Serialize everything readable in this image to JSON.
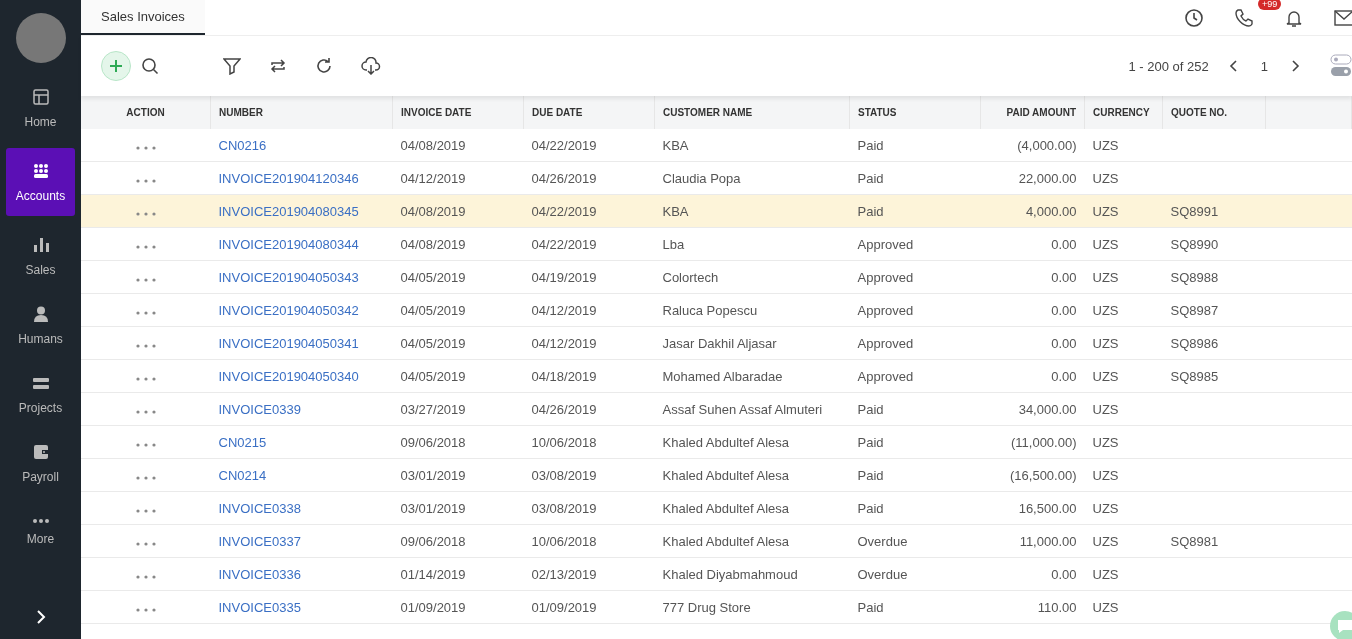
{
  "sidebar": {
    "items": [
      {
        "label": "Home",
        "selected": false
      },
      {
        "label": "Accounts",
        "selected": true
      },
      {
        "label": "Sales",
        "selected": false
      },
      {
        "label": "Humans",
        "selected": false
      },
      {
        "label": "Projects",
        "selected": false
      },
      {
        "label": "Payroll",
        "selected": false
      },
      {
        "label": "More",
        "selected": false
      }
    ]
  },
  "tabs": [
    {
      "label": "Sales Invoices",
      "selected": true
    }
  ],
  "header": {
    "notification_badge": "+99"
  },
  "pagination": {
    "range": "1 - 200 of 252",
    "page": "1"
  },
  "table": {
    "columns": [
      "ACTION",
      "NUMBER",
      "INVOICE DATE",
      "DUE DATE",
      "CUSTOMER NAME",
      "STATUS",
      "PAID AMOUNT",
      "CURRENCY",
      "QUOTE NO."
    ],
    "rows": [
      {
        "selected": false,
        "number": "CN0216",
        "invoice_date": "04/08/2019",
        "due_date": "04/22/2019",
        "customer": "KBA",
        "status": "Paid",
        "paid_amount": "(4,000.00)",
        "currency": "UZS",
        "quote_no": ""
      },
      {
        "selected": false,
        "number": "INVOICE201904120346",
        "invoice_date": "04/12/2019",
        "due_date": "04/26/2019",
        "customer": "Claudia Popa",
        "status": "Paid",
        "paid_amount": "22,000.00",
        "currency": "UZS",
        "quote_no": ""
      },
      {
        "selected": true,
        "number": "INVOICE201904080345",
        "invoice_date": "04/08/2019",
        "due_date": "04/22/2019",
        "customer": "KBA",
        "status": "Paid",
        "paid_amount": "4,000.00",
        "currency": "UZS",
        "quote_no": "SQ8991"
      },
      {
        "selected": false,
        "number": "INVOICE201904080344",
        "invoice_date": "04/08/2019",
        "due_date": "04/22/2019",
        "customer": "Lba",
        "status": "Approved",
        "paid_amount": "0.00",
        "currency": "UZS",
        "quote_no": "SQ8990"
      },
      {
        "selected": false,
        "number": "INVOICE201904050343",
        "invoice_date": "04/05/2019",
        "due_date": "04/19/2019",
        "customer": "Colortech",
        "status": "Approved",
        "paid_amount": "0.00",
        "currency": "UZS",
        "quote_no": "SQ8988"
      },
      {
        "selected": false,
        "number": "INVOICE201904050342",
        "invoice_date": "04/05/2019",
        "due_date": "04/12/2019",
        "customer": "Raluca Popescu",
        "status": "Approved",
        "paid_amount": "0.00",
        "currency": "UZS",
        "quote_no": "SQ8987"
      },
      {
        "selected": false,
        "number": "INVOICE201904050341",
        "invoice_date": "04/05/2019",
        "due_date": "04/12/2019",
        "customer": "Jasar Dakhil Aljasar",
        "status": "Approved",
        "paid_amount": "0.00",
        "currency": "UZS",
        "quote_no": "SQ8986"
      },
      {
        "selected": false,
        "number": "INVOICE201904050340",
        "invoice_date": "04/05/2019",
        "due_date": "04/18/2019",
        "customer": "Mohamed Albaradae",
        "status": "Approved",
        "paid_amount": "0.00",
        "currency": "UZS",
        "quote_no": "SQ8985"
      },
      {
        "selected": false,
        "number": "INVOICE0339",
        "invoice_date": "03/27/2019",
        "due_date": "04/26/2019",
        "customer": "Assaf Suhen Assaf Almuteri",
        "status": "Paid",
        "paid_amount": "34,000.00",
        "currency": "UZS",
        "quote_no": ""
      },
      {
        "selected": false,
        "number": "CN0215",
        "invoice_date": "09/06/2018",
        "due_date": "10/06/2018",
        "customer": "Khaled Abdultef Alesa",
        "status": "Paid",
        "paid_amount": "(11,000.00)",
        "currency": "UZS",
        "quote_no": ""
      },
      {
        "selected": false,
        "number": "CN0214",
        "invoice_date": "03/01/2019",
        "due_date": "03/08/2019",
        "customer": "Khaled Abdultef Alesa",
        "status": "Paid",
        "paid_amount": "(16,500.00)",
        "currency": "UZS",
        "quote_no": ""
      },
      {
        "selected": false,
        "number": "INVOICE0338",
        "invoice_date": "03/01/2019",
        "due_date": "03/08/2019",
        "customer": "Khaled Abdultef Alesa",
        "status": "Paid",
        "paid_amount": "16,500.00",
        "currency": "UZS",
        "quote_no": ""
      },
      {
        "selected": false,
        "number": "INVOICE0337",
        "invoice_date": "09/06/2018",
        "due_date": "10/06/2018",
        "customer": "Khaled Abdultef Alesa",
        "status": "Overdue",
        "paid_amount": "11,000.00",
        "currency": "UZS",
        "quote_no": "SQ8981"
      },
      {
        "selected": false,
        "number": "INVOICE0336",
        "invoice_date": "01/14/2019",
        "due_date": "02/13/2019",
        "customer": "Khaled Diyabmahmoud",
        "status": "Overdue",
        "paid_amount": "0.00",
        "currency": "UZS",
        "quote_no": ""
      },
      {
        "selected": false,
        "number": "INVOICE0335",
        "invoice_date": "01/09/2019",
        "due_date": "01/09/2019",
        "customer": "777 Drug Store",
        "status": "Paid",
        "paid_amount": "110.00",
        "currency": "UZS",
        "quote_no": ""
      }
    ]
  }
}
